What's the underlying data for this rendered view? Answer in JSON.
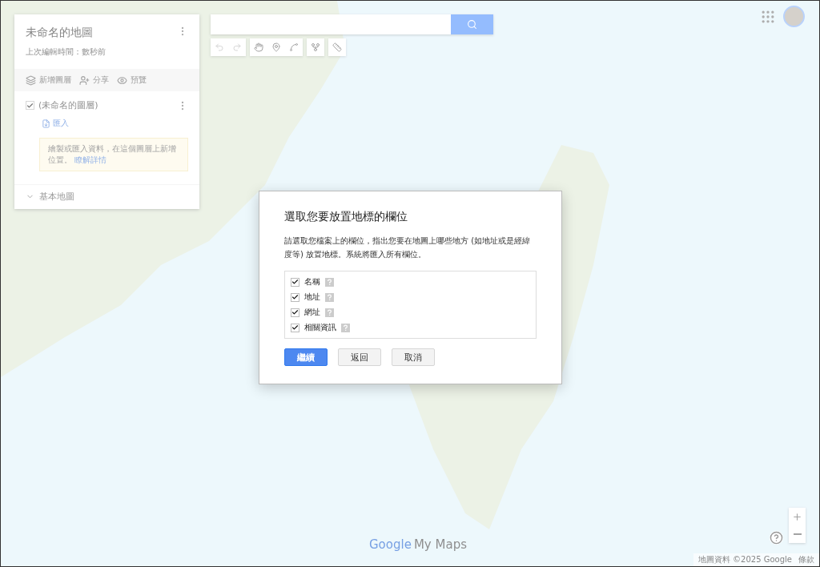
{
  "panel": {
    "title": "未命名的地圖",
    "subtitle": "上次編輯時間：數秒前",
    "actions": [
      {
        "label": "新增圖層",
        "kind": "layers"
      },
      {
        "label": "分享",
        "kind": "share"
      },
      {
        "label": "預覽",
        "kind": "preview"
      }
    ],
    "layer": {
      "name": "(未命名的圖層)",
      "checked": true,
      "import_link": "匯入",
      "hint": "繪製或匯入資料，在這個圖層上新增位置。",
      "hint_link": "瞭解詳情"
    },
    "base_map": {
      "label": "基本地圖",
      "expanded": false
    }
  },
  "toolbar": [
    {
      "kind": "undo",
      "disabled": true
    },
    {
      "kind": "redo",
      "disabled": true
    },
    {
      "kind": "hand",
      "disabled": false
    },
    {
      "kind": "marker",
      "disabled": false
    },
    {
      "kind": "line",
      "disabled": false
    },
    {
      "kind": "route",
      "disabled": false
    },
    {
      "kind": "measure",
      "disabled": false
    }
  ],
  "dialog": {
    "title": "選取您要放置地標的欄位",
    "description": "請選取您檔案上的欄位，指出您要在地圖上哪些地方 (如地址或是經緯度等) 放置地標。系統將匯入所有欄位。",
    "fields": [
      {
        "label": "名稱",
        "checked": true
      },
      {
        "label": "地址",
        "checked": true
      },
      {
        "label": "網址",
        "checked": true
      },
      {
        "label": "相關資訊",
        "checked": true
      }
    ],
    "buttons": [
      {
        "label": "繼續",
        "kind": "primary"
      },
      {
        "label": "返回",
        "kind": "secondary"
      },
      {
        "label": "取消",
        "kind": "secondary"
      }
    ]
  },
  "logo": {
    "brand": "Google",
    "product": "My Maps"
  },
  "map_footer": {
    "attribution": "地圖資料 ©2025 Google",
    "terms": "條款"
  }
}
